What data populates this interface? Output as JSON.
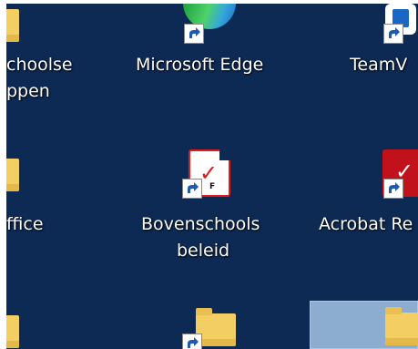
{
  "desktop": {
    "background_color": "#0d2a55",
    "icons": [
      {
        "label_line1": "choolse",
        "label_line2": "ppen",
        "icon": "folder-icon"
      },
      {
        "label_line1": "Microsoft Edge",
        "icon": "edge-icon"
      },
      {
        "label_line1": "TeamV",
        "icon": "teamviewer-icon"
      },
      {
        "label_line1": "ffice",
        "icon": "folder-icon"
      },
      {
        "label_line1": "Bovenschools",
        "label_line2": "beleid",
        "icon": "pdf-file-icon"
      },
      {
        "label_line1": "Acrobat Re",
        "icon": "acrobat-icon"
      },
      {
        "label_line1": "",
        "icon": "folder-icon"
      },
      {
        "label_line1": "",
        "icon": "folder-icon"
      },
      {
        "label_line1": "",
        "icon": "folder-icon"
      }
    ],
    "pdf_glyph": "✓",
    "pdf_sub": "F",
    "acrobat_glyph": "✓",
    "shortcut_arrow": "shortcut-arrow-icon"
  }
}
